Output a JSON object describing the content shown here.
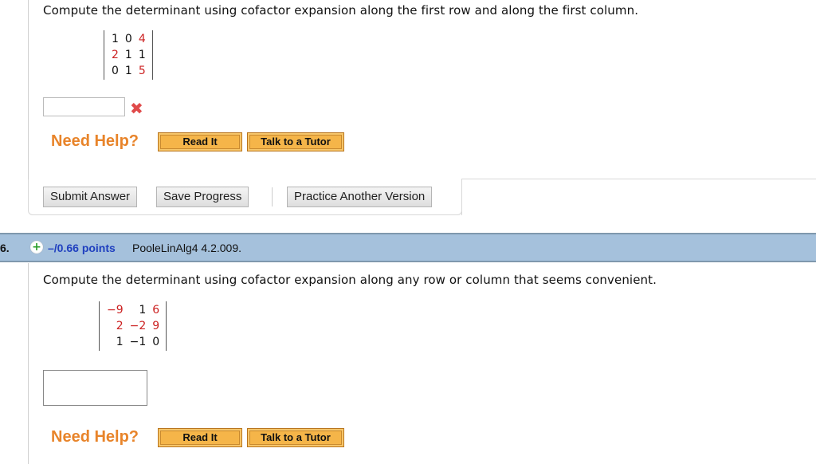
{
  "question5": {
    "prompt": "Compute the determinant using cofactor expansion along the first row and along the first column.",
    "matrix": [
      [
        {
          "v": "1",
          "hl": false
        },
        {
          "v": "0",
          "hl": false
        },
        {
          "v": "4",
          "hl": true
        }
      ],
      [
        {
          "v": "2",
          "hl": true
        },
        {
          "v": "1",
          "hl": false
        },
        {
          "v": "1",
          "hl": false
        }
      ],
      [
        {
          "v": "0",
          "hl": false
        },
        {
          "v": "1",
          "hl": false
        },
        {
          "v": "5",
          "hl": true
        }
      ]
    ],
    "answer_value": "",
    "status_icon": "incorrect-x-icon",
    "status_glyph": "✖",
    "need_help": "Need Help?",
    "read_it": "Read It",
    "talk_tutor": "Talk to a Tutor",
    "submit": "Submit Answer",
    "save": "Save Progress",
    "practice": "Practice Another Version"
  },
  "question6": {
    "number": "6.",
    "expand_glyph": "+",
    "points": "–/0.66 points",
    "source": "PooleLinAlg4 4.2.009.",
    "prompt": "Compute the determinant using cofactor expansion along any row or column that seems convenient.",
    "matrix": [
      [
        {
          "v": "−9",
          "hl": true
        },
        {
          "v": "1",
          "hl": false
        },
        {
          "v": "6",
          "hl": true
        }
      ],
      [
        {
          "v": "2",
          "hl": true
        },
        {
          "v": "−2",
          "hl": true
        },
        {
          "v": "9",
          "hl": true
        }
      ],
      [
        {
          "v": "1",
          "hl": false
        },
        {
          "v": "−1",
          "hl": false
        },
        {
          "v": "0",
          "hl": false
        }
      ]
    ],
    "answer_value": "",
    "need_help": "Need Help?",
    "read_it": "Read It",
    "talk_tutor": "Talk to a Tutor"
  },
  "colors": {
    "highlight": "#cc2222",
    "need_help": "#e8842a",
    "points": "#1f3fbf",
    "question_bar": "#a5c1dc"
  }
}
